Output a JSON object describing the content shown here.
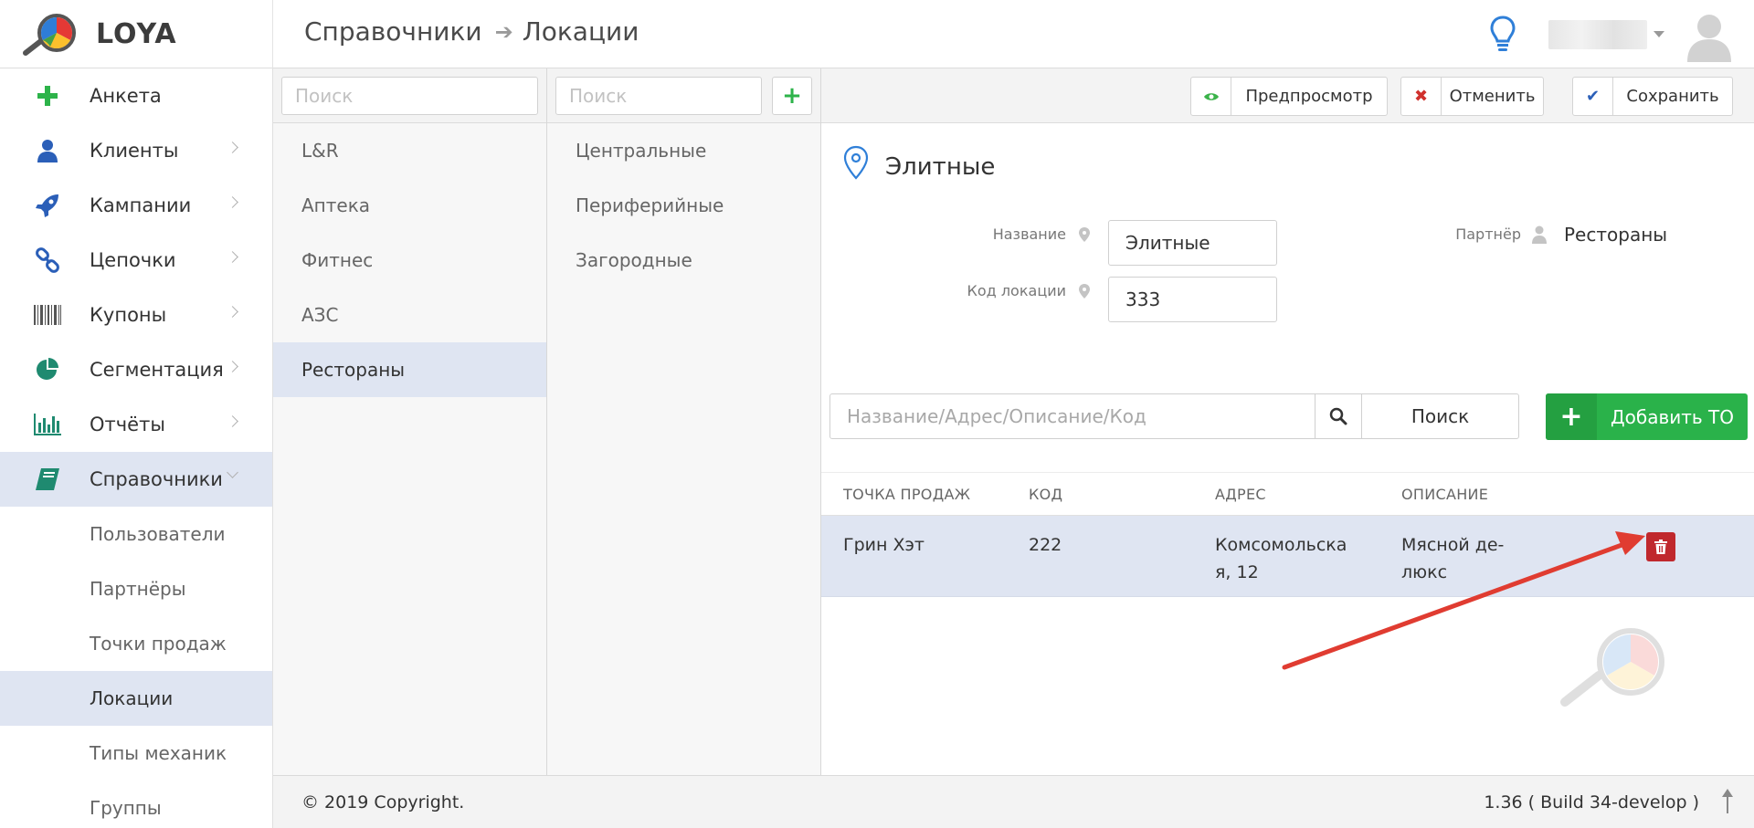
{
  "app": {
    "logo_text": "LOYA"
  },
  "breadcrumb": {
    "parent": "Справочники",
    "current": "Локации"
  },
  "sidebar": {
    "items": [
      {
        "label": "Анкета",
        "icon": "plus-icon"
      },
      {
        "label": "Клиенты",
        "icon": "user-icon"
      },
      {
        "label": "Кампании",
        "icon": "rocket-icon"
      },
      {
        "label": "Цепочки",
        "icon": "chain-icon"
      },
      {
        "label": "Купоны",
        "icon": "barcode-icon"
      },
      {
        "label": "Сегментация",
        "icon": "pie-icon"
      },
      {
        "label": "Отчёты",
        "icon": "bar-chart-icon"
      },
      {
        "label": "Справочники",
        "icon": "book-icon"
      }
    ],
    "subitems": [
      "Пользователи",
      "Партнёры",
      "Точки продаж",
      "Локации",
      "Типы механик",
      "Группы"
    ]
  },
  "col1": {
    "search_placeholder": "Поиск",
    "items": [
      "L&R",
      "Аптека",
      "Фитнес",
      "АЗС",
      "Рестораны"
    ]
  },
  "col2": {
    "search_placeholder": "Поиск",
    "add_label": "+",
    "items": [
      "Центральные",
      "Периферийные",
      "Загородные"
    ]
  },
  "toolbar": {
    "preview": "Предпросмотр",
    "cancel": "Отменить",
    "save": "Сохранить"
  },
  "location": {
    "title": "Элитные",
    "name_label": "Название",
    "name_value": "Элитные",
    "code_label": "Код локации",
    "code_value": "333",
    "partner_label": "Партнёр",
    "partner_value": "Рестораны"
  },
  "to_search": {
    "placeholder": "Название/Адрес/Описание/Код",
    "button": "Поиск",
    "add_button": "Добавить ТО",
    "add_icon": "+"
  },
  "table": {
    "headers": [
      "ТОЧКА ПРОДАЖ",
      "КОД",
      "АДРЕС",
      "ОПИСАНИЕ"
    ],
    "rows": [
      {
        "point": "Грин Хэт",
        "code": "222",
        "address_l1": "Комсомольска",
        "address_l2": "я, 12",
        "desc_l1": "Мясной де-",
        "desc_l2": "люкс"
      }
    ]
  },
  "footer": {
    "copyright": "© 2019 Copyright.",
    "version": "1.36 ( Build 34-develop )"
  },
  "colors": {
    "accent_green": "#2ab24a",
    "active_bg": "#dfe5f2",
    "delete_red": "#c0282d",
    "arrow_red": "#e03c31"
  }
}
